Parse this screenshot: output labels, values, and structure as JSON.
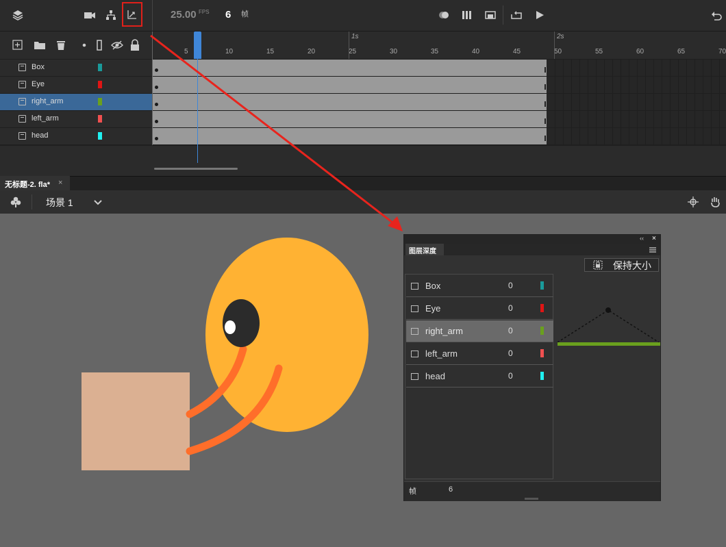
{
  "toolbar": {
    "fps_value": "25.00",
    "fps_unit": "FPS",
    "frame_value": "6",
    "frame_unit": "帧"
  },
  "layers": [
    {
      "name": "Box",
      "color": "#1a9a9a"
    },
    {
      "name": "Eye",
      "color": "#e01515"
    },
    {
      "name": "right_arm",
      "color": "#6aa01e",
      "selected": true
    },
    {
      "name": "left_arm",
      "color": "#f05050"
    },
    {
      "name": "head",
      "color": "#20f0f0"
    }
  ],
  "ruler": {
    "ticks": [
      "5",
      "10",
      "15",
      "20",
      "25",
      "30",
      "35",
      "40",
      "45",
      "50",
      "55",
      "60",
      "65",
      "70"
    ],
    "seconds": [
      "1s",
      "2s"
    ]
  },
  "document": {
    "tab_title": "无标题-2. fla*",
    "close_glyph": "×",
    "scene_name": "场景 1"
  },
  "stage_colors": {
    "background": "#666666",
    "head": "#ffb233",
    "eye": "#2b2b2b",
    "box": "#dbb092",
    "arm": "#ff6e2a"
  },
  "depth_panel": {
    "tab_title": "图层深度",
    "keep_size_label": "保持大小",
    "rows": [
      {
        "name": "Box",
        "depth": "0",
        "color": "#1a9a9a"
      },
      {
        "name": "Eye",
        "depth": "0",
        "color": "#e01515"
      },
      {
        "name": "right_arm",
        "depth": "0",
        "color": "#6aa01e",
        "selected": true
      },
      {
        "name": "left_arm",
        "depth": "0",
        "color": "#f05050"
      },
      {
        "name": "head",
        "depth": "0",
        "color": "#20f0f0"
      }
    ],
    "footer_label": "帧",
    "footer_value": "6"
  }
}
